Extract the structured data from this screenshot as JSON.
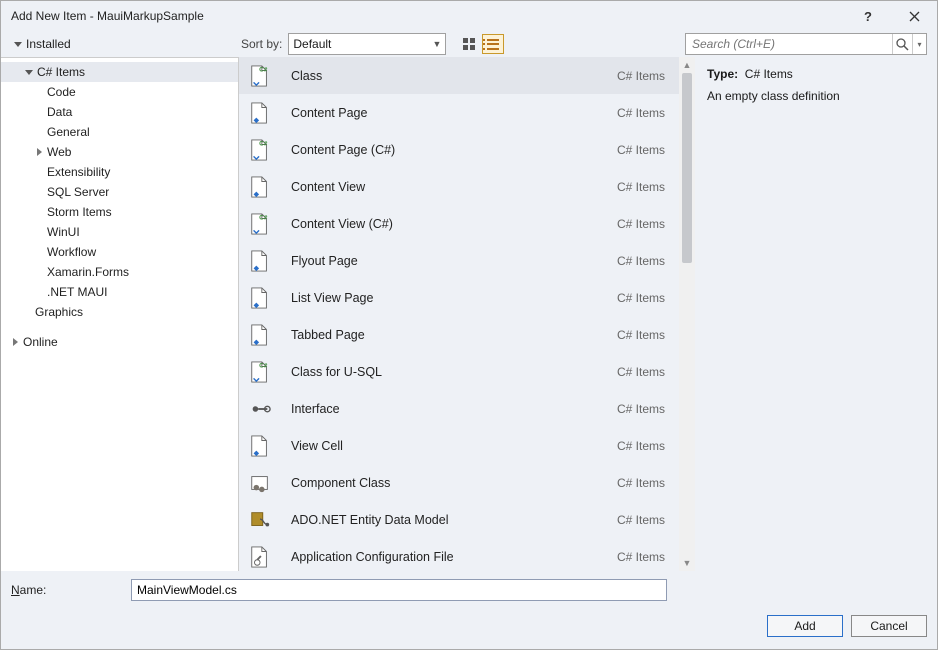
{
  "title": "Add New Item - MauiMarkupSample",
  "tree": {
    "installed_label": "Installed",
    "online_label": "Online",
    "cs_items_label": "C# Items",
    "items": [
      "Code",
      "Data",
      "General",
      "Web",
      "Extensibility",
      "SQL Server",
      "Storm Items",
      "WinUI",
      "Workflow",
      "Xamarin.Forms",
      ".NET MAUI"
    ],
    "graphics_label": "Graphics"
  },
  "sort": {
    "label": "Sort by:",
    "value": "Default"
  },
  "search": {
    "placeholder": "Search (Ctrl+E)"
  },
  "templates": [
    {
      "label": "Class",
      "cat": "C# Items",
      "icon": "cs"
    },
    {
      "label": "Content Page",
      "cat": "C# Items",
      "icon": "xaml"
    },
    {
      "label": "Content Page (C#)",
      "cat": "C# Items",
      "icon": "cs"
    },
    {
      "label": "Content View",
      "cat": "C# Items",
      "icon": "xaml"
    },
    {
      "label": "Content View (C#)",
      "cat": "C# Items",
      "icon": "cs"
    },
    {
      "label": "Flyout Page",
      "cat": "C# Items",
      "icon": "xaml"
    },
    {
      "label": "List View Page",
      "cat": "C# Items",
      "icon": "xaml"
    },
    {
      "label": "Tabbed Page",
      "cat": "C# Items",
      "icon": "xaml"
    },
    {
      "label": "Class for U-SQL",
      "cat": "C# Items",
      "icon": "cs"
    },
    {
      "label": "Interface",
      "cat": "C# Items",
      "icon": "iface"
    },
    {
      "label": "View Cell",
      "cat": "C# Items",
      "icon": "xaml"
    },
    {
      "label": "Component Class",
      "cat": "C# Items",
      "icon": "comp"
    },
    {
      "label": "ADO.NET Entity Data Model",
      "cat": "C# Items",
      "icon": "ado"
    },
    {
      "label": "Application Configuration File",
      "cat": "C# Items",
      "icon": "cfg"
    }
  ],
  "detail": {
    "type_label": "Type:",
    "type_value": "C# Items",
    "desc": "An empty class definition"
  },
  "name": {
    "label": "Name:",
    "value": "MainViewModel.cs"
  },
  "buttons": {
    "add": "Add",
    "cancel": "Cancel"
  }
}
